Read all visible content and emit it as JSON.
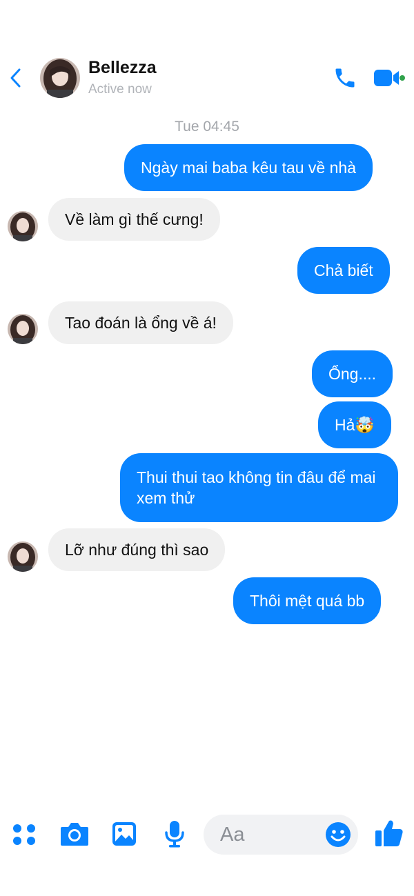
{
  "header": {
    "contact_name": "Bellezza",
    "status": "Active now"
  },
  "timestamp": "Tue 04:45",
  "messages": [
    {
      "sender": "me",
      "text": "Ngày mai baba kêu tau về nhà"
    },
    {
      "sender": "them",
      "text": "Về làm gì thế cưng!"
    },
    {
      "sender": "me",
      "text": "Chả biết"
    },
    {
      "sender": "them",
      "text": "Tao đoán là ổng về á!"
    },
    {
      "sender": "me",
      "text": "Ổng...."
    },
    {
      "sender": "me",
      "text": "Hả🤯"
    },
    {
      "sender": "me",
      "text": "Thui thui tao không tin đâu để mai xem thử"
    },
    {
      "sender": "them",
      "text": "Lỡ như đúng thì sao"
    },
    {
      "sender": "me",
      "text": "Thôi mệt quá bb"
    }
  ],
  "composer": {
    "placeholder": "Aa",
    "icons": [
      "apps-icon",
      "camera-icon",
      "image-icon",
      "mic-icon",
      "emoji-icon",
      "like-icon"
    ]
  },
  "colors": {
    "accent": "#0a84ff",
    "incoming_bubble": "#f0f0f0",
    "online_dot": "#31a24c"
  }
}
